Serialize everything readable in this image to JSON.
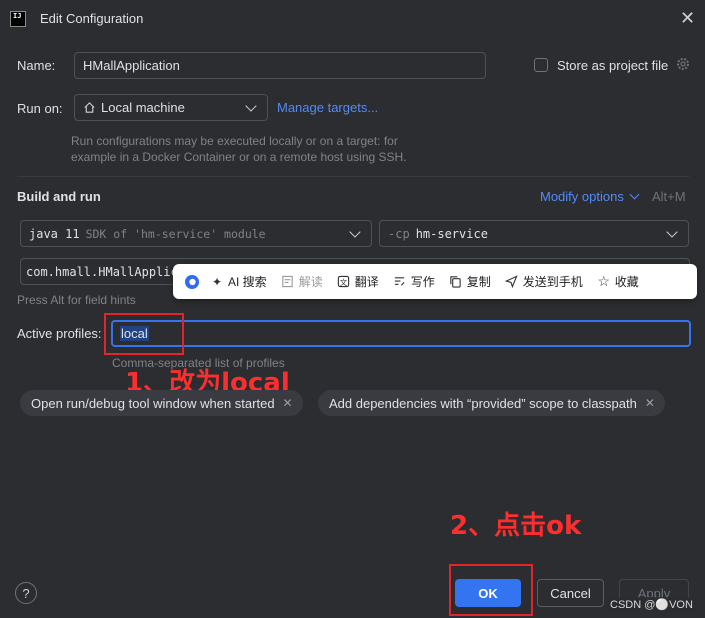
{
  "window": {
    "title": "Edit Configuration",
    "app_icon_text": "IJ"
  },
  "name_field": {
    "label": "Name:",
    "value": "HMallApplication"
  },
  "store_project": {
    "label": "Store as project file"
  },
  "run_on": {
    "label": "Run on:",
    "value": "Local machine",
    "manage_link": "Manage targets..."
  },
  "run_on_hint": [
    "Run configurations may be executed locally or on a target: for",
    "example in a Docker Container or on a remote host using SSH."
  ],
  "build_run": {
    "heading": "Build and run",
    "modify_options": "Modify options",
    "modify_shortcut": "Alt+M",
    "sdk_bold": "java 11",
    "sdk_rest": "SDK of 'hm-service' module",
    "cp_prefix": "-cp",
    "cp_value": "hm-service",
    "main_class": "com.hmall.HMallApplica",
    "field_hint": "Press Alt for field hints"
  },
  "active_profiles": {
    "label": "Active profiles:",
    "value": "local",
    "hint": "Comma-separated list of profiles"
  },
  "chips": [
    {
      "label": "Open run/debug tool window when started"
    },
    {
      "label": "Add dependencies with “provided” scope to classpath"
    }
  ],
  "toolbar": {
    "items": [
      {
        "icon": "ai-sparkle-icon",
        "label": "AI 搜索"
      },
      {
        "icon": "explain-icon",
        "label": "解读"
      },
      {
        "icon": "translate-icon",
        "label": "翻译"
      },
      {
        "icon": "write-icon",
        "label": "写作"
      },
      {
        "icon": "copy-icon",
        "label": "复制"
      },
      {
        "icon": "send-icon",
        "label": "发送到手机"
      },
      {
        "icon": "star-icon",
        "label": "收藏"
      }
    ]
  },
  "annotations": {
    "step1": "1、改为local",
    "step2": "2、点击ok"
  },
  "buttons": {
    "ok": "OK",
    "cancel": "Cancel",
    "apply": "Apply",
    "help": "?"
  },
  "watermark": "CSDN @⚪VON",
  "colors": {
    "accent": "#3574f0",
    "link": "#548af7",
    "annotation_red": "#ff2e2e",
    "background": "#2b2d30"
  }
}
